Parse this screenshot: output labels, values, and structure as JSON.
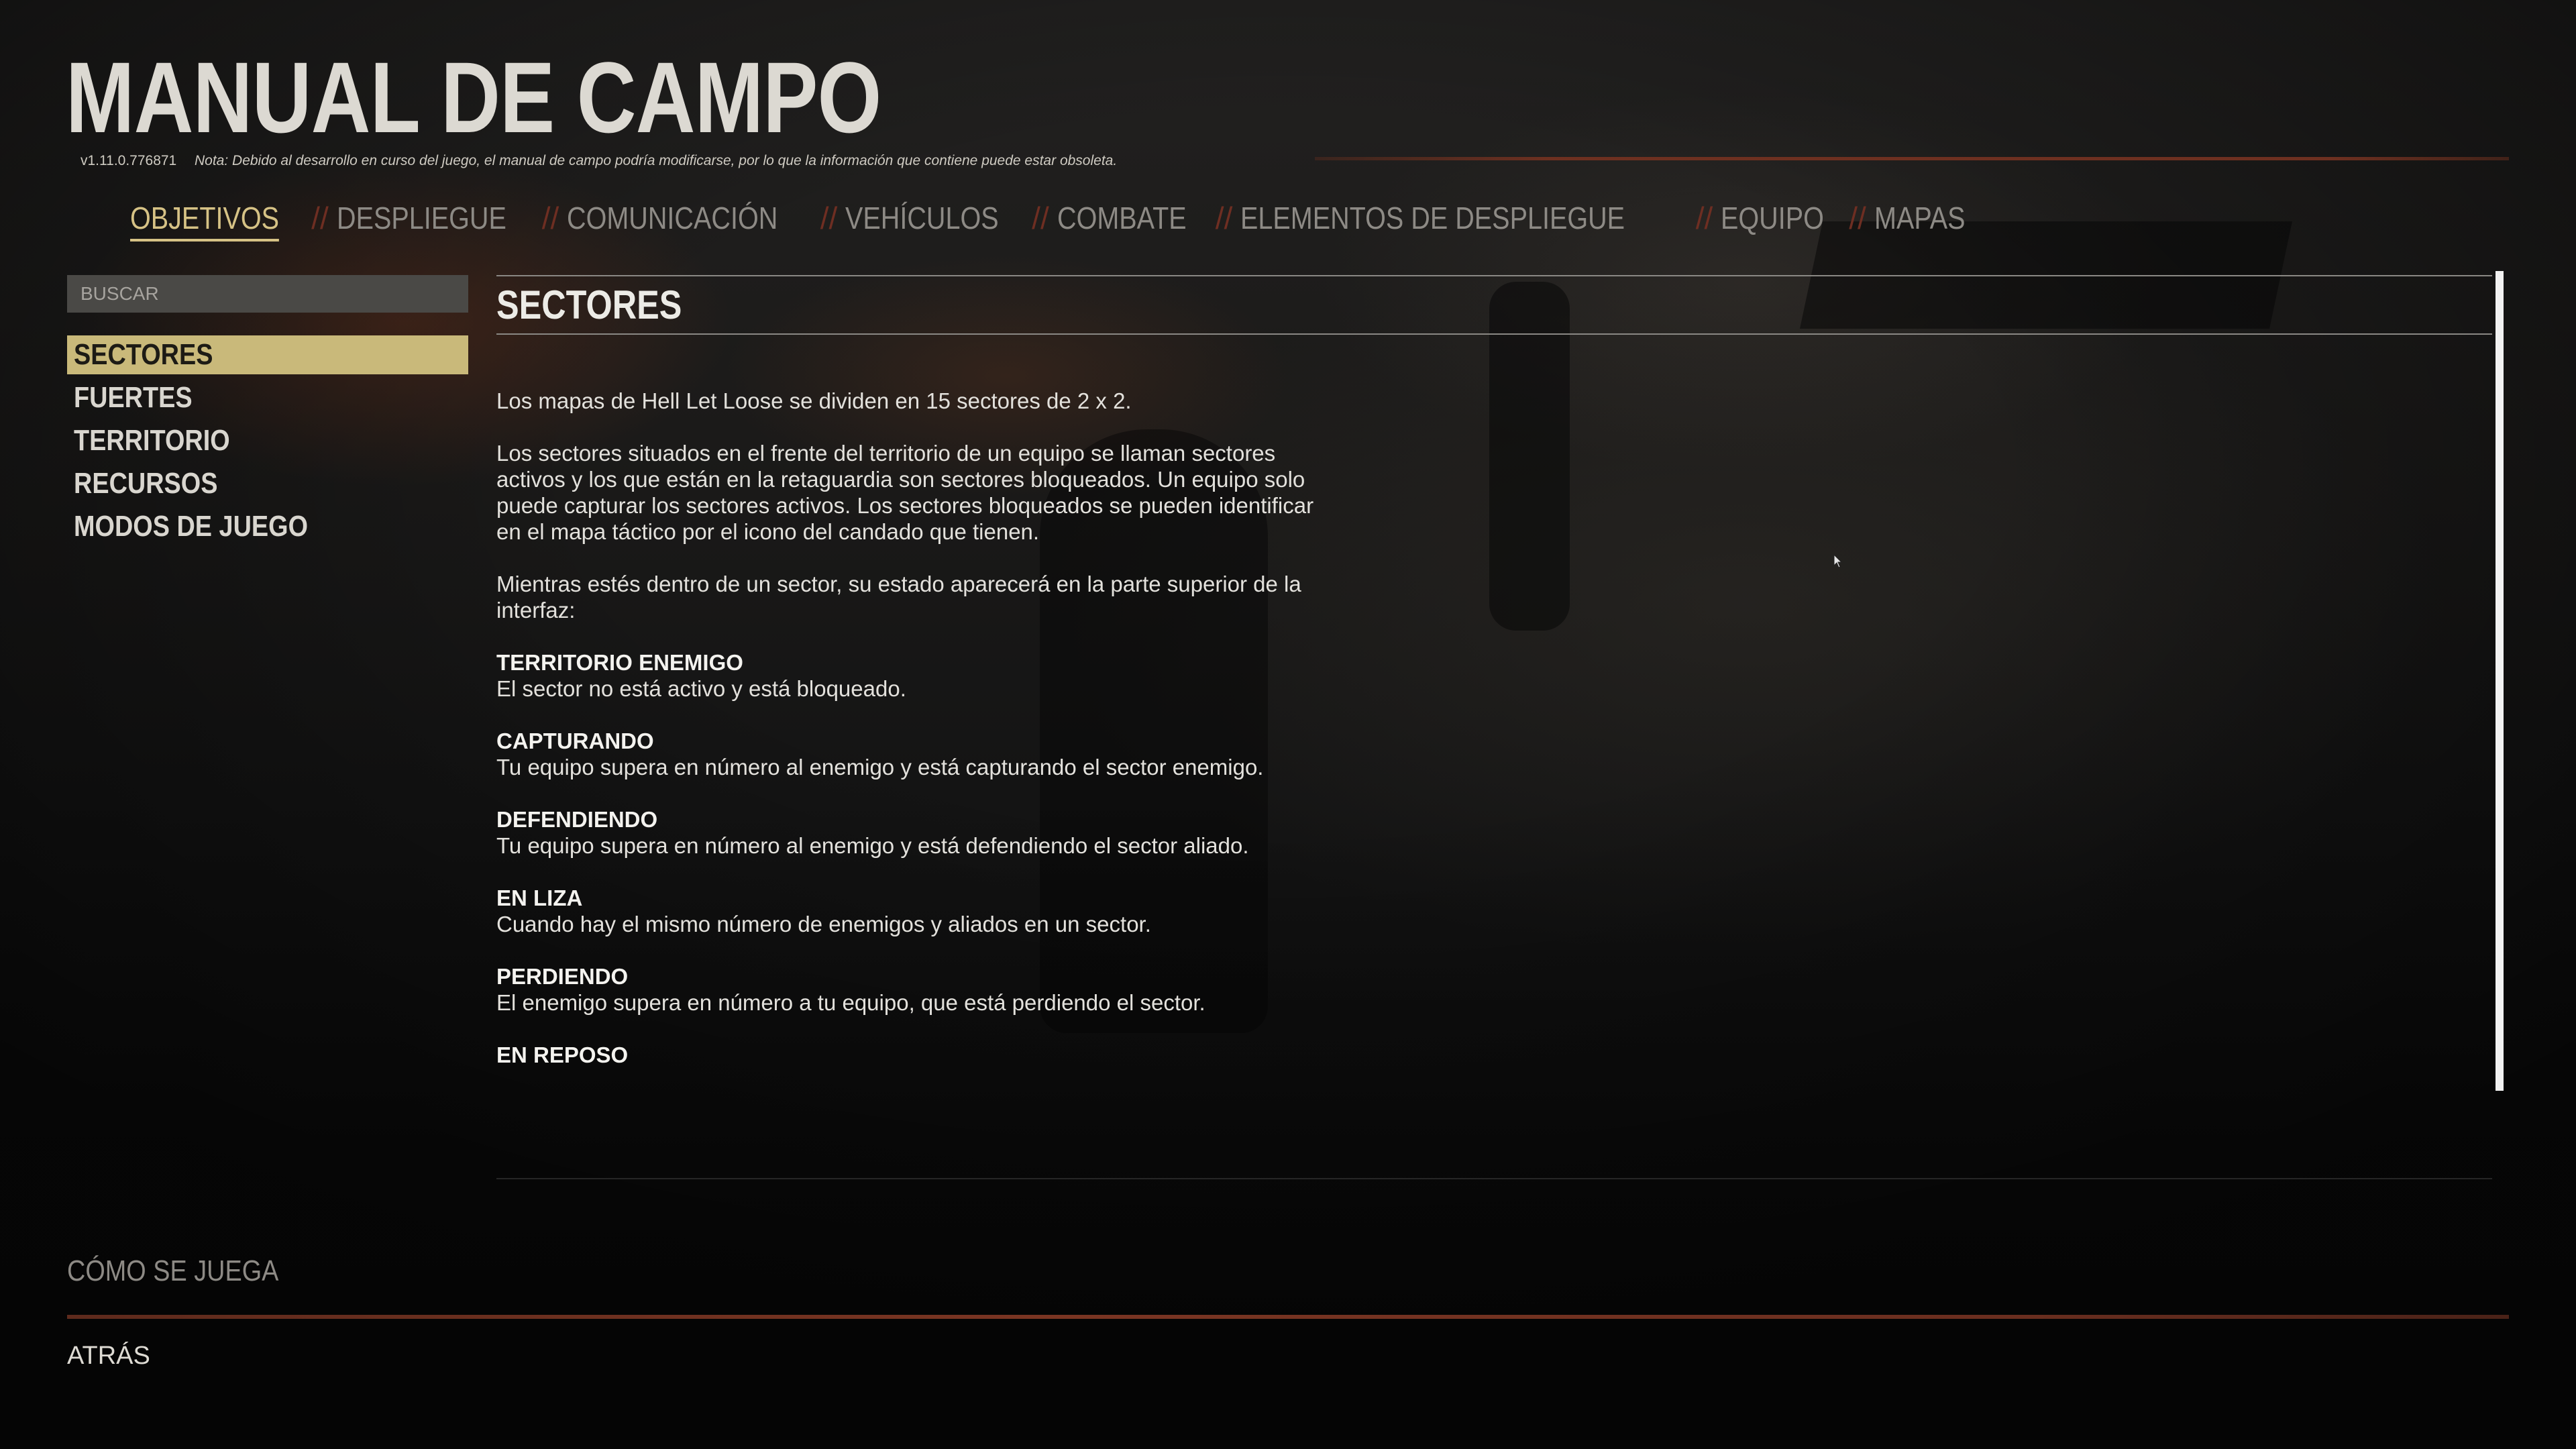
{
  "header": {
    "title": "MANUAL DE CAMPO",
    "version": "v1.11.0.776871",
    "note": "Nota: Debido al desarrollo en curso del juego, el manual de campo podría modificarse, por lo que la información que contiene puede estar obsoleta."
  },
  "tabs": [
    {
      "label": "OBJETIVOS",
      "active": true
    },
    {
      "label": "DESPLIEGUE"
    },
    {
      "label": "COMUNICACIÓN"
    },
    {
      "label": "VEHÍCULOS"
    },
    {
      "label": "COMBATE"
    },
    {
      "label": "ELEMENTOS DE DESPLIEGUE"
    },
    {
      "label": "EQUIPO"
    },
    {
      "label": "MAPAS"
    }
  ],
  "tab_separator": "//",
  "search": {
    "placeholder": "BUSCAR"
  },
  "sidebar": {
    "items": [
      {
        "label": "SECTORES",
        "active": true
      },
      {
        "label": "FUERTES"
      },
      {
        "label": "TERRITORIO"
      },
      {
        "label": "RECURSOS"
      },
      {
        "label": "MODOS DE JUEGO"
      }
    ]
  },
  "article": {
    "title": "SECTORES",
    "intro": "Los mapas de Hell Let Loose se dividen en 15 sectores de 2 x 2.",
    "paragraph2": "Los sectores situados en el frente del territorio de un equipo se llaman sectores activos y los que están en la retaguardia son sectores bloqueados. Un equipo solo puede capturar los sectores activos. Los sectores bloqueados se pueden identificar en el mapa táctico por el icono del candado que tienen.",
    "paragraph3": "Mientras estés dentro de un sector, su estado aparecerá en la parte superior de la interfaz:",
    "states": [
      {
        "name": "TERRITORIO ENEMIGO",
        "desc": "El sector no está activo y está bloqueado."
      },
      {
        "name": "CAPTURANDO",
        "desc": "Tu equipo supera en número al enemigo y está capturando el sector enemigo."
      },
      {
        "name": "DEFENDIENDO",
        "desc": "Tu equipo supera en número al enemigo y está defendiendo el sector aliado."
      },
      {
        "name": "EN LIZA",
        "desc": "Cuando hay el mismo número de enemigos y aliados en un sector."
      },
      {
        "name": "PERDIENDO",
        "desc": "El enemigo supera en número a tu equipo, que está perdiendo el sector."
      },
      {
        "name": "EN REPOSO",
        "desc": ""
      }
    ]
  },
  "footer": {
    "how_to_play": "CÓMO SE JUEGA",
    "back": "ATRÁS"
  },
  "colors": {
    "accent_gold": "#d6c285",
    "sidebar_active_bg": "#c9b97a",
    "divider_rust": "#6e3020"
  }
}
